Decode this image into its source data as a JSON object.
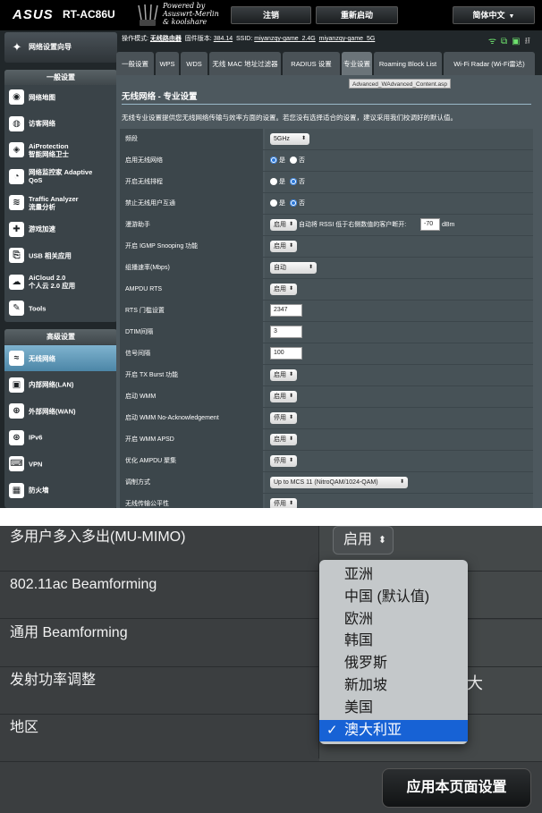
{
  "header": {
    "brand": "ASUS",
    "model": "RT-AC86U",
    "powered_by": [
      "Powered by",
      "Asuswrt-Merlin",
      "& koolshare"
    ],
    "logout": "注销",
    "reboot": "重新启动",
    "language": "简体中文"
  },
  "sidebar": {
    "qis": "网络设置向导",
    "general_title": "一般设置",
    "general_items": [
      {
        "icon": "network-map-icon",
        "glyph": "◉",
        "label": "网络地图"
      },
      {
        "icon": "guest-network-icon",
        "glyph": "◍",
        "label": "访客网络"
      },
      {
        "icon": "aiprotection-icon",
        "glyph": "◈",
        "label": "AiProtection",
        "sub": "智能网络卫士"
      },
      {
        "icon": "adaptive-qos-icon",
        "glyph": "◔",
        "label": "网络监控家 Adaptive",
        "sub": "QoS"
      },
      {
        "icon": "traffic-analyzer-icon",
        "glyph": "≋",
        "label": "Traffic Analyzer",
        "sub": "流量分析"
      },
      {
        "icon": "game-boost-icon",
        "glyph": "✚",
        "label": "游戏加速"
      },
      {
        "icon": "usb-icon",
        "glyph": "⎘",
        "label": "USB 相关应用"
      },
      {
        "icon": "aicloud-icon",
        "glyph": "☁",
        "label": "AiCloud 2.0",
        "sub": "个人云 2.0 应用"
      },
      {
        "icon": "tools-icon",
        "glyph": "✎",
        "label": "Tools"
      }
    ],
    "advanced_title": "高级设置",
    "advanced_items": [
      {
        "icon": "wireless-icon",
        "glyph": "≈",
        "label": "无线网络",
        "active": true
      },
      {
        "icon": "lan-icon",
        "glyph": "▣",
        "label": "内部网络(LAN)"
      },
      {
        "icon": "wan-icon",
        "glyph": "⊕",
        "label": "外部网络(WAN)"
      },
      {
        "icon": "ipv6-icon",
        "glyph": "⊛",
        "label": "IPv6"
      },
      {
        "icon": "vpn-icon",
        "glyph": "⌨",
        "label": "VPN"
      },
      {
        "icon": "firewall-icon",
        "glyph": "▦",
        "label": "防火墙"
      }
    ]
  },
  "opbar": {
    "mode_label": "操作模式:",
    "mode_value": "无线路由器",
    "fw_label": "固件版本:",
    "fw_value": "384.14",
    "ssid_label": "SSID:",
    "ssid1": "miyanzqy-game_2.4G",
    "ssid2": "miyanzqy-game_5G"
  },
  "tabs": [
    {
      "label": "一般设置"
    },
    {
      "label": "WPS"
    },
    {
      "label": "WDS"
    },
    {
      "label": "无线 MAC 地址过滤器"
    },
    {
      "label": "RADIUS 设置"
    },
    {
      "label": "专业设置",
      "active": true
    },
    {
      "label": "Roaming Block List"
    },
    {
      "label": "Wi-Fi Radar (Wi-Fi雷达)"
    }
  ],
  "tooltip": "Advanced_WAdvanced_Content.asp",
  "page": {
    "title": "无线网络 - 专业设置",
    "description": "无线专业设置提供您无线网络传输与效率方面的设置。若您没有选择适合的设置，建议采用我们校调好的默认值。"
  },
  "rows": [
    {
      "label": "频段",
      "type": "select",
      "value": "5GHz"
    },
    {
      "label": "启用无线网络",
      "type": "radio",
      "yes": "是",
      "no": "否",
      "selected": "yes"
    },
    {
      "label": "开启无线排程",
      "type": "radio",
      "yes": "是",
      "no": "否",
      "selected": "no"
    },
    {
      "label": "禁止无线用户互通",
      "type": "radio",
      "yes": "是",
      "no": "否",
      "selected": "no"
    },
    {
      "label": "漫游助手",
      "type": "roaming",
      "value": "启用",
      "text1": "自动将 RSSI 低于右侧数值的客户断开:",
      "rssi": "-70",
      "unit": "dBm"
    },
    {
      "label": "开启 IGMP Snooping 功能",
      "type": "select",
      "value": "启用"
    },
    {
      "label": "组播速率(Mbps)",
      "type": "select",
      "value": "自动"
    },
    {
      "label": "AMPDU RTS",
      "type": "select",
      "value": "启用"
    },
    {
      "label": "RTS 门槛设置",
      "type": "input",
      "value": "2347"
    },
    {
      "label": "DTIM间隔",
      "type": "input",
      "value": "3"
    },
    {
      "label": "信号间隔",
      "type": "input",
      "value": "100"
    },
    {
      "label": "开启 TX Burst 功能",
      "type": "select",
      "value": "启用"
    },
    {
      "label": "启动 WMM",
      "type": "select",
      "value": "启用"
    },
    {
      "label": "启动 WMM No-Acknowledgement",
      "type": "select",
      "value": "停用"
    },
    {
      "label": "开启 WMM APSD",
      "type": "select",
      "value": "启用"
    },
    {
      "label": "优化 AMPDU 聚集",
      "type": "select",
      "value": "停用"
    },
    {
      "label": "调制方式",
      "type": "select",
      "value": "Up to MCS 11 (NitroQAM/1024-QAM)"
    },
    {
      "label": "无线传输公平性",
      "type": "select",
      "value": "停用"
    }
  ],
  "bottom": {
    "rows": [
      {
        "label": "多用户多入多出(MU-MIMO)"
      },
      {
        "label": "802.11ac Beamforming"
      },
      {
        "label": "通用 Beamforming"
      },
      {
        "label": "发射功率调整"
      },
      {
        "label": "地区"
      }
    ],
    "mimo_value": "启用",
    "power_tail": "大",
    "region_options": [
      "亚洲",
      "中国 (默认值)",
      "欧洲",
      "韩国",
      "俄罗斯",
      "新加坡",
      "美国",
      "澳大利亚"
    ],
    "region_selected": "澳大利亚",
    "apply": "应用本页面设置"
  }
}
